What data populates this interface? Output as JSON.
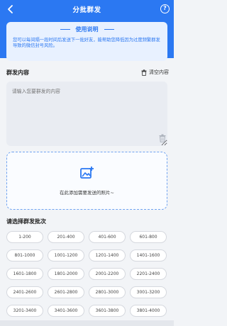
{
  "header": {
    "title": "分批群发",
    "back_icon": "chevron-left-icon",
    "help_icon": "question-circle-icon",
    "help_symbol": "?"
  },
  "notice": {
    "title": "使用说明",
    "text": "您可以每间隔一段时间后发送下一批好友，能帮助您降低因为过度频繁群发导致的微信封号风险。"
  },
  "content": {
    "label": "群发内容",
    "clear_label": "清空内容",
    "placeholder": "请输入您要群发的内容"
  },
  "upload": {
    "text": "在此添加需要发送的照片~",
    "icon": "image-add-icon"
  },
  "batch": {
    "label": "请选择群发批次",
    "options": [
      "1-200",
      "201-400",
      "401-600",
      "601-800",
      "801-1000",
      "1001-1200",
      "1201-1400",
      "1401-1600",
      "1601-1800",
      "1801-2000",
      "2001-2200",
      "2201-2400",
      "2401-2600",
      "2601-2800",
      "2801-3000",
      "3001-3200",
      "3201-3400",
      "3401-3600",
      "3601-3800",
      "3801-4000"
    ]
  },
  "colors": {
    "primary": "#2b78f2",
    "notice_bg": "#e8f1ff"
  }
}
